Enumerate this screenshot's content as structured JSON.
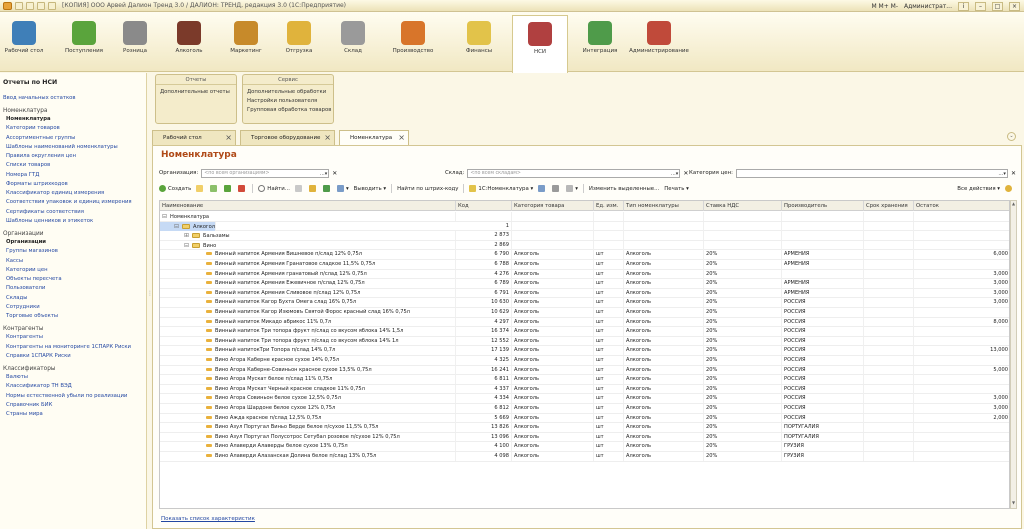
{
  "window": {
    "title": "[КОПИЯ] ООО Арвей Далион Тренд 3.0 / ДАЛИОН: ТРЕНД, редакция 3.0 (1С:Предприятие)",
    "memory_buttons": "M  M+  M-",
    "user": "Администрат..."
  },
  "sections": [
    {
      "label": "Рабочий стол",
      "color": "#3f7fb8"
    },
    {
      "label": "Поступления",
      "color": "#5aa43c"
    },
    {
      "label": "Розница",
      "color": "#8a8a8a"
    },
    {
      "label": "Алкоголь",
      "color": "#7b3a2a"
    },
    {
      "label": "Маркетинг",
      "color": "#c78a2a"
    },
    {
      "label": "Отгрузка",
      "color": "#e0b33c"
    },
    {
      "label": "Склад",
      "color": "#9a9a9a"
    },
    {
      "label": "Производство",
      "color": "#d8752a"
    },
    {
      "label": "Финансы",
      "color": "#e2c34a"
    },
    {
      "label": "НСИ",
      "color": "#b04040"
    },
    {
      "label": "Интеграция",
      "color": "#4f9b4a"
    },
    {
      "label": "Администрирование",
      "color": "#c04a3a"
    }
  ],
  "sidebar": {
    "title": "Отчеты по НСИ",
    "top_link": "Ввод начальных остатков",
    "groups": [
      {
        "header": "Номенклатура",
        "items": [
          "Номенклатура",
          "Категории товаров",
          "Ассортиментные группы",
          "Шаблоны наименований номенклатуры",
          "Правила округления цен",
          "Списки товаров",
          "Номера ГТД",
          "Форматы штрихкодов",
          "Классификатор единиц измерения",
          "Соответствия упаковок и единиц измерения",
          "Сертификаты соответствия",
          "Шаблоны ценников и этикеток"
        ]
      },
      {
        "header": "Организации",
        "items": [
          "Организации",
          "Группы магазинов",
          "Кассы",
          "Категории цен",
          "Объекты пересчета",
          "Пользователи",
          "Склады",
          "Сотрудники",
          "Торговые объекты"
        ]
      },
      {
        "header": "Контрагенты",
        "items": [
          "Контрагенты",
          "Контрагенты на мониторинге 1СПАРК Риски",
          "Справки 1СПАРК Риски"
        ]
      },
      {
        "header": "Классификаторы",
        "items": [
          "Валюты",
          "Классификатор ТН ВЭД",
          "Нормы естественной убыли по реализации",
          "Справочник БИК",
          "Страны мира"
        ]
      }
    ]
  },
  "commands": {
    "reports": {
      "header": "Отчеты",
      "items": [
        "Дополнительные отчеты"
      ]
    },
    "service": {
      "header": "Сервис",
      "items": [
        "Дополнительные обработки",
        "Настройки пользователя",
        "Групповая обработка товаров"
      ]
    }
  },
  "tabs": [
    "Рабочий стол",
    "Торговое оборудование",
    "Номенклатура"
  ],
  "page": {
    "title": "Номенклатура",
    "org_label": "Организация:",
    "org_placeholder": "<по всем организациям>",
    "store_label": "Склад:",
    "store_placeholder": "<по всем складам>",
    "price_label": "Категория цен:"
  },
  "toolbar": {
    "create": "Создать",
    "find": "Найти...",
    "output": "Выводить",
    "barcode": "Найти по штрих-коду",
    "nom1c": "1С:Номенклатура",
    "change": "Изменить выделенные...",
    "print": "Печать",
    "all": "Все действия"
  },
  "columns": [
    "Наименование",
    "Код",
    "Категория товара",
    "Ед. изм.",
    "Тип номенклатуры",
    "Ставка НДС",
    "Производитель",
    "Срок хранения",
    "Остаток"
  ],
  "tree": [
    {
      "name": "Номенклатура",
      "code": ""
    },
    {
      "name": "Алкоголь",
      "code": "1"
    },
    {
      "name": "Бальзамы",
      "code": "2 873"
    },
    {
      "name": "Вино",
      "code": "2 869"
    }
  ],
  "items": [
    {
      "name": "Винный напиток Армения Вишневое п/слад 12% 0,75л",
      "code": "6 790",
      "cat": "Алкоголь",
      "unit": "шт",
      "type": "Алкоголь",
      "vat": "20%",
      "maker": "АРМЕНИЯ",
      "rest": "6,000"
    },
    {
      "name": "Винный напиток Армения Гранатовое сладкое 11,5% 0,75л",
      "code": "6 788",
      "cat": "Алкоголь",
      "unit": "шт",
      "type": "Алкоголь",
      "vat": "20%",
      "maker": "АРМЕНИЯ",
      "rest": ""
    },
    {
      "name": "Винный напиток Армения гранатовый п/слад 12% 0,75л",
      "code": "4 276",
      "cat": "Алкоголь",
      "unit": "шт",
      "type": "Алкоголь",
      "vat": "20%",
      "maker": "",
      "rest": "3,000"
    },
    {
      "name": "Винный напиток Армения Ежевичное п/слад 12% 0,75л",
      "code": "6 789",
      "cat": "Алкоголь",
      "unit": "шт",
      "type": "Алкоголь",
      "vat": "20%",
      "maker": "АРМЕНИЯ",
      "rest": "3,000"
    },
    {
      "name": "Винный напиток Армения Сливовое п/слад 12% 0,75л",
      "code": "6 791",
      "cat": "Алкоголь",
      "unit": "шт",
      "type": "Алкоголь",
      "vat": "20%",
      "maker": "АРМЕНИЯ",
      "rest": "3,000"
    },
    {
      "name": "Винный напиток Кагор Бухта Омега слад 16% 0,75л",
      "code": "10 630",
      "cat": "Алкоголь",
      "unit": "шт",
      "type": "Алкоголь",
      "vat": "20%",
      "maker": "РОССИЯ",
      "rest": "3,000"
    },
    {
      "name": "Винный напиток Кагор Изюмовъ Святой Форос красный слад 16% 0,75л",
      "code": "10 629",
      "cat": "Алкоголь",
      "unit": "шт",
      "type": "Алкоголь",
      "vat": "20%",
      "maker": "РОССИЯ",
      "rest": ""
    },
    {
      "name": "Винный напиток Микадо абрикос 11% 0,7л",
      "code": "4 297",
      "cat": "Алкоголь",
      "unit": "шт",
      "type": "Алкоголь",
      "vat": "20%",
      "maker": "РОССИЯ",
      "rest": "8,000"
    },
    {
      "name": "Винный напиток Три топора фрукт п/слад со вкусом яблока 14% 1,5л",
      "code": "16 374",
      "cat": "Алкоголь",
      "unit": "шт",
      "type": "Алкоголь",
      "vat": "20%",
      "maker": "РОССИЯ",
      "rest": ""
    },
    {
      "name": "Винный напиток Три топора фрукт п/слад со вкусом яблока 14% 1л",
      "code": "12 552",
      "cat": "Алкоголь",
      "unit": "шт",
      "type": "Алкоголь",
      "vat": "20%",
      "maker": "РОССИЯ",
      "rest": ""
    },
    {
      "name": "Винный напитокТри Топора п/слад 14% 0,7л",
      "code": "17 139",
      "cat": "Алкоголь",
      "unit": "шт",
      "type": "Алкоголь",
      "vat": "20%",
      "maker": "РОССИЯ",
      "rest": "13,000"
    },
    {
      "name": "Вино Агора Каберне красное сухое 14% 0,75л",
      "code": "4 325",
      "cat": "Алкоголь",
      "unit": "шт",
      "type": "Алкоголь",
      "vat": "20%",
      "maker": "РОССИЯ",
      "rest": ""
    },
    {
      "name": "Вино Агора Каберне-Совиньон красное сухое 13,5% 0,75л",
      "code": "16 241",
      "cat": "Алкоголь",
      "unit": "шт",
      "type": "Алкоголь",
      "vat": "20%",
      "maker": "РОССИЯ",
      "rest": "5,000"
    },
    {
      "name": "Вино Агора Мускат белое п/слад 11% 0,75л",
      "code": "6 811",
      "cat": "Алкоголь",
      "unit": "шт",
      "type": "Алкоголь",
      "vat": "20%",
      "maker": "РОССИЯ",
      "rest": ""
    },
    {
      "name": "Вино Агора Мускат Черный красное сладкое 11% 0,75л",
      "code": "4 337",
      "cat": "Алкоголь",
      "unit": "шт",
      "type": "Алкоголь",
      "vat": "20%",
      "maker": "РОССИЯ",
      "rest": ""
    },
    {
      "name": "Вино Агора Совиньон белое сухое 12,5% 0,75л",
      "code": "4 334",
      "cat": "Алкоголь",
      "unit": "шт",
      "type": "Алкоголь",
      "vat": "20%",
      "maker": "РОССИЯ",
      "rest": "3,000"
    },
    {
      "name": "Вино Агора Шардоне белое сухое 12% 0,75л",
      "code": "6 812",
      "cat": "Алкоголь",
      "unit": "шт",
      "type": "Алкоголь",
      "vat": "20%",
      "maker": "РОССИЯ",
      "rest": "3,000"
    },
    {
      "name": "Вино Ажда красное п/слад 12,5% 0,75л",
      "code": "5 669",
      "cat": "Алкоголь",
      "unit": "шт",
      "type": "Алкоголь",
      "vat": "20%",
      "maker": "РОССИЯ",
      "rest": "2,000"
    },
    {
      "name": "Вино Азул Португал Виньо Верде белое п/сухое 11,5% 0,75л",
      "code": "13 826",
      "cat": "Алкоголь",
      "unit": "шт",
      "type": "Алкоголь",
      "vat": "20%",
      "maker": "ПОРТУГАЛИЯ",
      "rest": ""
    },
    {
      "name": "Вино Азул Португал Полусотрос Сетубал розовое п/сухое 12% 0,75л",
      "code": "13 096",
      "cat": "Алкоголь",
      "unit": "шт",
      "type": "Алкоголь",
      "vat": "20%",
      "maker": "ПОРТУГАЛИЯ",
      "rest": ""
    },
    {
      "name": "Вино Алаверди Алаверды белое сухое 13% 0,75л",
      "code": "4 100",
      "cat": "Алкоголь",
      "unit": "шт",
      "type": "Алкоголь",
      "vat": "20%",
      "maker": "ГРУЗИЯ",
      "rest": ""
    },
    {
      "name": "Вино Алаверди Алазанская Долина белое п/слад 13% 0,75л",
      "code": "4 098",
      "cat": "Алкоголь",
      "unit": "шт",
      "type": "Алкоголь",
      "vat": "20%",
      "maker": "ГРУЗИЯ",
      "rest": ""
    }
  ],
  "footer_link": "Показать список характеристик"
}
